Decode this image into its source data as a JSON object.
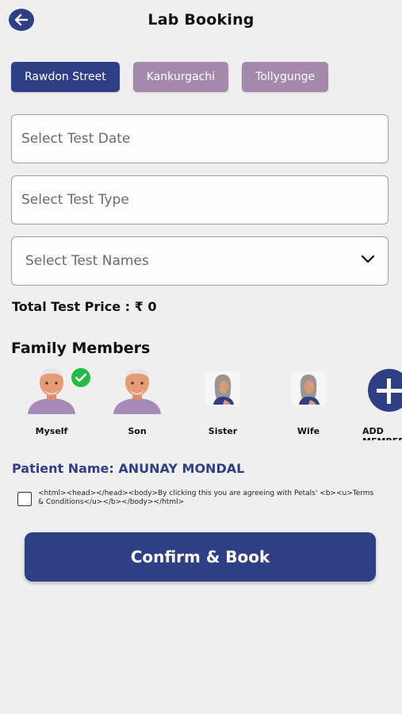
{
  "header": {
    "title": "Lab Booking",
    "back_icon": "arrow-left-icon"
  },
  "branches": [
    {
      "label": "Rawdon Street",
      "selected": true
    },
    {
      "label": "Kankurgachi",
      "selected": false
    },
    {
      "label": "Tollygunge",
      "selected": false
    }
  ],
  "fields": {
    "test_date_placeholder": "Select Test Date",
    "test_type_placeholder": "Select Test Type",
    "test_names_placeholder": "Select Test Names"
  },
  "price": {
    "text": "Total Test Price :  ₹ 0"
  },
  "family": {
    "title": "Family Members",
    "members": [
      {
        "label": "Myself",
        "selected": true
      },
      {
        "label": "Son",
        "selected": false
      },
      {
        "label": "Sister",
        "selected": false
      },
      {
        "label": "Wife",
        "selected": false
      },
      {
        "label": "ADD MEMBER",
        "selected": false
      }
    ]
  },
  "patient": {
    "text": "Patient Name: ANUNAY MONDAL"
  },
  "terms": {
    "text": "<html><head></head><body>By clicking this you are agreeing with Petals' <b><u>Terms & Conditions</u></b></body></html>",
    "checked": false
  },
  "actions": {
    "confirm_label": "Confirm & Book"
  },
  "colors": {
    "primary": "#2f3f86",
    "secondary": "#a489ad",
    "success": "#22bb44",
    "background": "#efeff0"
  }
}
